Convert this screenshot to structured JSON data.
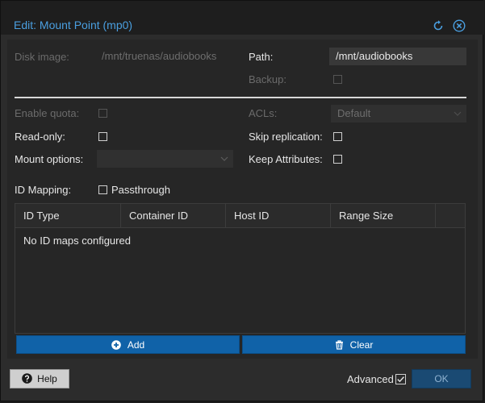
{
  "dialog": {
    "title": "Edit: Mount Point (mp0)",
    "icons": [
      "reset-icon",
      "close-icon"
    ]
  },
  "form": {
    "disk_image_label": "Disk image:",
    "disk_image_value": "/mnt/truenas/audiobooks",
    "path_label": "Path:",
    "path_value": "/mnt/audiobooks",
    "backup_label": "Backup:",
    "enable_quota_label": "Enable quota:",
    "acls_label": "ACLs:",
    "acls_value": "Default",
    "read_only_label": "Read-only:",
    "skip_replication_label": "Skip replication:",
    "mount_options_label": "Mount options:",
    "mount_options_value": "",
    "keep_attributes_label": "Keep Attributes:",
    "id_mapping_label": "ID Mapping:",
    "passthrough_label": "Passthrough"
  },
  "grid": {
    "columns": [
      "ID Type",
      "Container ID",
      "Host ID",
      "Range Size"
    ],
    "empty_text": "No ID maps configured"
  },
  "buttons": {
    "add_label": "Add",
    "clear_label": "Clear",
    "help_label": "Help",
    "advanced_label": "Advanced",
    "ok_label": "OK"
  },
  "colors": {
    "title": "#4a9fe0",
    "accent_button": "#1062a8",
    "ok_button": "#1a4a73"
  }
}
